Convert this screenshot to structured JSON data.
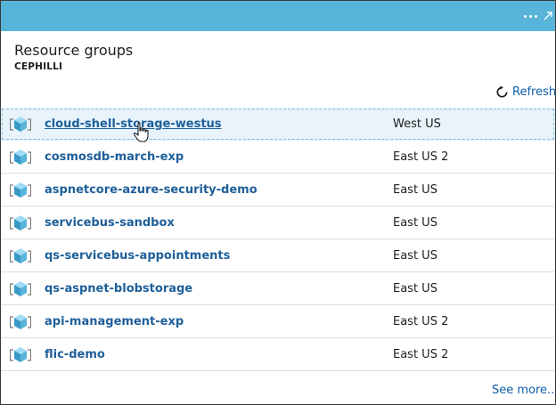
{
  "blade": {
    "title": "Resource groups",
    "subtitle": "CEPHILLI",
    "refresh_label": "Refresh",
    "see_more_label": "See more..."
  },
  "resource_groups": [
    {
      "name": "cloud-shell-storage-westus",
      "location": "West US"
    },
    {
      "name": "cosmosdb-march-exp",
      "location": "East US 2"
    },
    {
      "name": "aspnetcore-azure-security-demo",
      "location": "East US"
    },
    {
      "name": "servicebus-sandbox",
      "location": "East US"
    },
    {
      "name": "qs-servicebus-appointments",
      "location": "East US"
    },
    {
      "name": "qs-aspnet-blobstorage",
      "location": "East US"
    },
    {
      "name": "api-management-exp",
      "location": "East US 2"
    },
    {
      "name": "flic-demo",
      "location": "East US 2"
    }
  ],
  "icons": {
    "topbar_more": "ellipsis-icon",
    "topbar_expand": "expand-icon",
    "refresh": "refresh-icon",
    "resource_group": "resource-group-cube-icon",
    "cursor": "hand-pointer-cursor-icon"
  },
  "colors": {
    "header_bar": "#59b4d9",
    "link": "#1e5f9a",
    "accent_link": "#0f5ea8",
    "selected_row": "#e8f3fb"
  }
}
